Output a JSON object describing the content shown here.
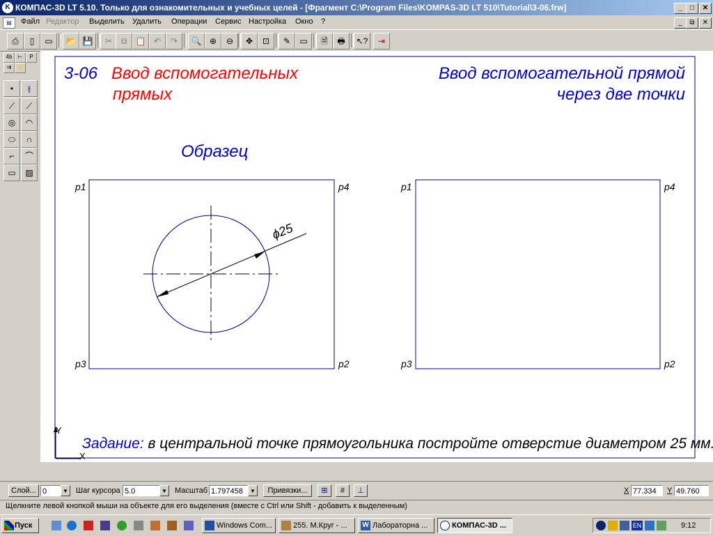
{
  "window": {
    "title": "КОМПАС-3D LT 5.10. Только для ознакомительных и учебных целей - [Фрагмент C:\\Program Files\\KOMPAS-3D LT 510\\Tutorial\\3-06.frw]",
    "controls": {
      "minimize": "_",
      "maximize": "□",
      "close": "✕",
      "restore": "⧉"
    }
  },
  "menu": [
    {
      "label": "Файл"
    },
    {
      "label": "Редактор",
      "disabled": true
    },
    {
      "label": "Выделить"
    },
    {
      "label": "Удалить"
    },
    {
      "label": "Операции"
    },
    {
      "label": "Сервис"
    },
    {
      "label": "Настройка"
    },
    {
      "label": "Окно"
    },
    {
      "label": "?"
    }
  ],
  "toolbar_icons": [
    "printer-icon",
    "new-icon",
    "new-doc-icon",
    "open-icon",
    "save-icon",
    "cut-icon",
    "copy-icon",
    "paste-icon",
    "undo-icon",
    "redo-icon",
    "zoom-icon",
    "zoom-in-icon",
    "zoom-out-icon",
    "pan-icon",
    "zoom-fit-icon",
    "pen-icon",
    "panel-icon",
    "preview-icon",
    "print-icon",
    "help-cursor-icon",
    "exit-icon"
  ],
  "left_tabs": {
    "tab1": "4b",
    "tab2": "Р"
  },
  "drawing": {
    "task_id": "3-06",
    "heading_left_line1": "Ввод вспомогательных",
    "heading_left_line2": "прямых",
    "heading_right_line1": "Ввод вспомогательной прямой",
    "heading_right_line2": "через две точки",
    "sample_label": "Образец",
    "dimension_label": "ϕ25",
    "points_left": {
      "p1": "p1",
      "p2": "p2",
      "p3": "p3",
      "p4": "p4"
    },
    "points_right": {
      "p1": "p1",
      "p2": "p2",
      "p3": "p3",
      "p4": "p4"
    },
    "task_prefix": "Задание:",
    "task_text": " в центральной точке прямоугольника постройте отверстие диаметром 25 мм.",
    "axis_x": "X",
    "axis_y": "Y",
    "colors": {
      "red": "#ff0000",
      "blue": "#0000cc",
      "frame": "#00008b"
    }
  },
  "status": {
    "layer_button": "Слой...",
    "layer_value": "0",
    "step_label": "Шаг курсора",
    "step_value": "5.0",
    "scale_label": "Масштаб",
    "scale_value": "1.797458",
    "snap_button": "Привязки...",
    "x_label": "X",
    "x_value": "77.334",
    "y_label": "Y",
    "y_value": "49.760"
  },
  "hint": "Щелкните левой кнопкой мыши на объекте для его выделения (вместе с Ctrl или Shift - добавить к выделенным)",
  "taskbar": {
    "start": "Пуск",
    "tasks": [
      {
        "label": "Windows Com..."
      },
      {
        "label": "255. М.Круг - ..."
      },
      {
        "label": "Лабораторна ..."
      },
      {
        "label": "КОМПАС-3D ...",
        "active": true
      }
    ],
    "tray_lang": "EN",
    "clock": "9:12"
  }
}
